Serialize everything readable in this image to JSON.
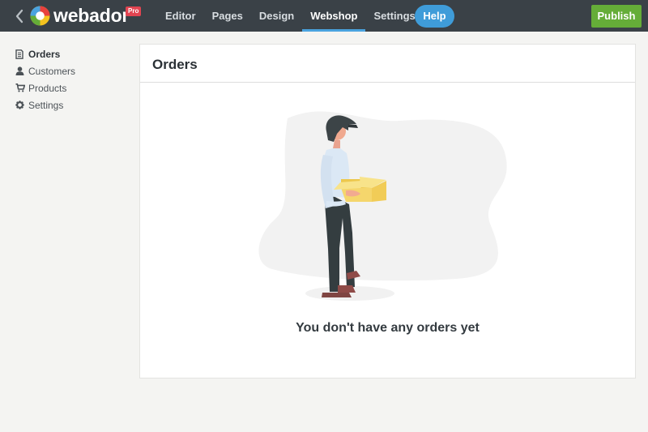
{
  "app": {
    "brand": "webador",
    "badge": "Pro"
  },
  "nav": {
    "items": [
      {
        "label": "Editor",
        "active": false
      },
      {
        "label": "Pages",
        "active": false
      },
      {
        "label": "Design",
        "active": false
      },
      {
        "label": "Webshop",
        "active": true
      },
      {
        "label": "Settings",
        "active": false
      }
    ],
    "help_label": "Help",
    "publish_label": "Publish"
  },
  "sidebar": {
    "items": [
      {
        "label": "Orders",
        "icon": "document-icon",
        "active": true
      },
      {
        "label": "Customers",
        "icon": "user-icon",
        "active": false
      },
      {
        "label": "Products",
        "icon": "cart-icon",
        "active": false
      },
      {
        "label": "Settings",
        "icon": "gear-icon",
        "active": false
      }
    ]
  },
  "main": {
    "title": "Orders",
    "empty_message": "You don't have any orders yet"
  },
  "colors": {
    "topbar": "#3a4147",
    "accent": "#4aa3df",
    "publish": "#65ad38",
    "badge": "#e24451"
  }
}
